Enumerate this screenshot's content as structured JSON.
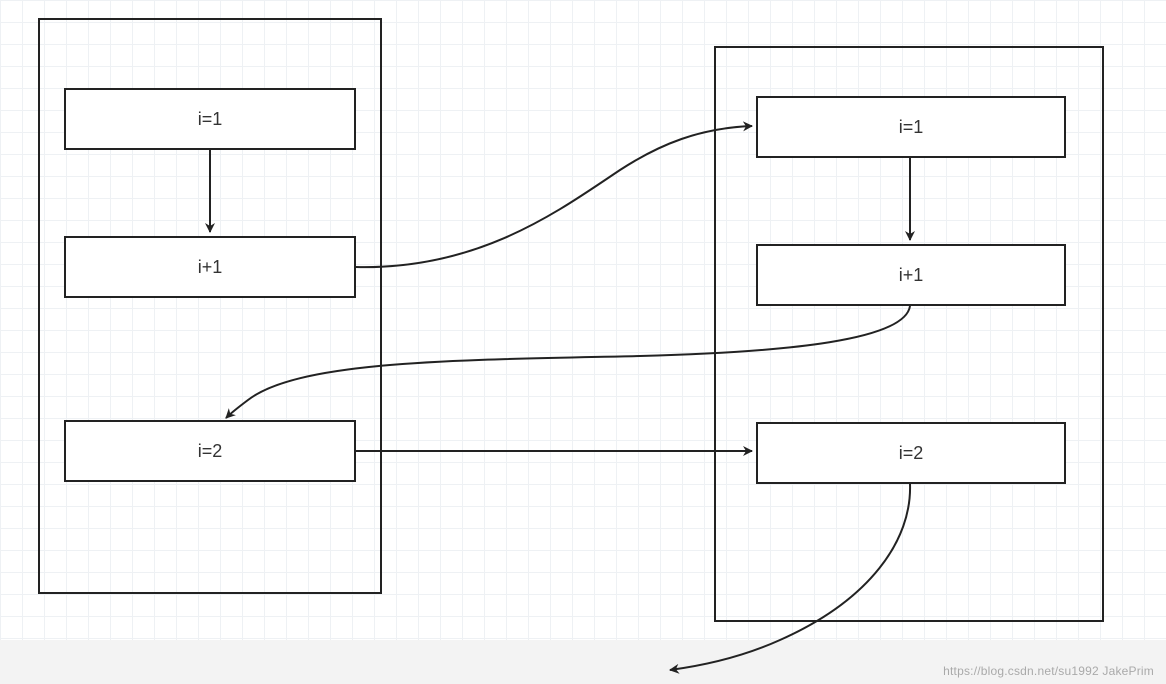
{
  "left": {
    "n1": "i=1",
    "n2": "i+1",
    "n3": "i=2"
  },
  "right": {
    "n1": "i=1",
    "n2": "i+1",
    "n3": "i=2"
  },
  "watermark": "https://blog.csdn.net/su1992   JakePrim",
  "colors": {
    "stroke": "#222"
  }
}
